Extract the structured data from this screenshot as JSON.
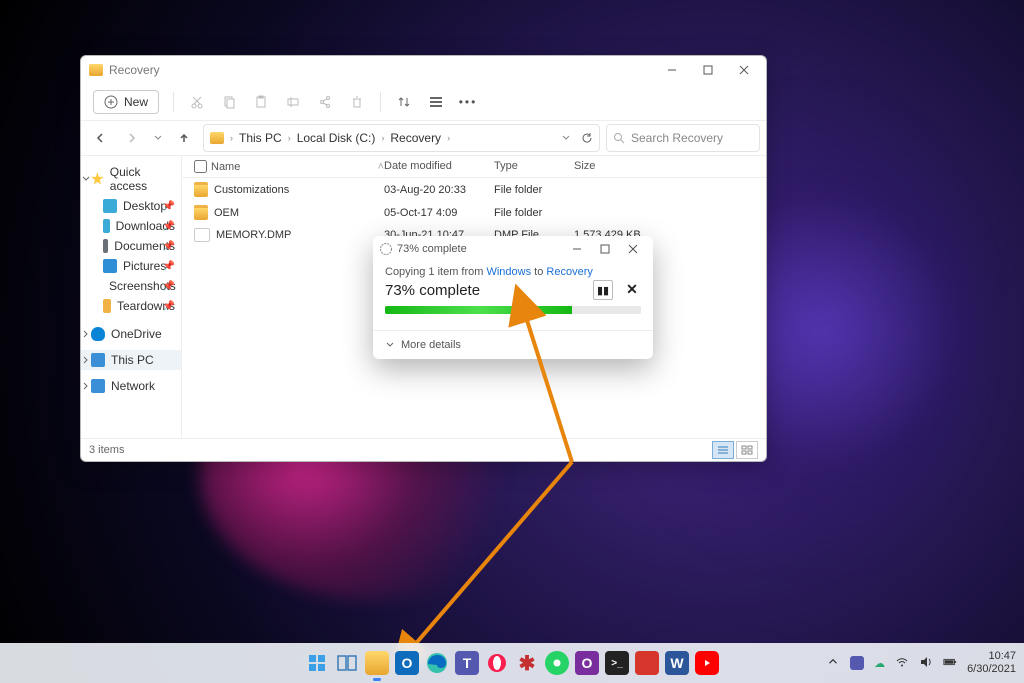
{
  "explorer": {
    "title": "Recovery",
    "new_label": "New",
    "breadcrumbs": [
      "This PC",
      "Local Disk (C:)",
      "Recovery"
    ],
    "search_placeholder": "Search Recovery",
    "columns": {
      "name": "Name",
      "date": "Date modified",
      "type": "Type",
      "size": "Size"
    },
    "rows": [
      {
        "name": "Customizations",
        "date": "03-Aug-20 20:33",
        "type": "File folder",
        "size": "",
        "icon": "folder"
      },
      {
        "name": "OEM",
        "date": "05-Oct-17 4:09",
        "type": "File folder",
        "size": "",
        "icon": "folder"
      },
      {
        "name": "MEMORY.DMP",
        "date": "30-Jun-21 10:47",
        "type": "DMP File",
        "size": "1,573,429 KB",
        "icon": "file"
      }
    ],
    "status": "3 items",
    "sidebar": {
      "quick_access": "Quick access",
      "items": [
        {
          "label": "Desktop",
          "color": "#3aaad6"
        },
        {
          "label": "Downloads",
          "color": "#3aaad6"
        },
        {
          "label": "Documents",
          "color": "#6a7178"
        },
        {
          "label": "Pictures",
          "color": "#2e8fd6"
        },
        {
          "label": "Screenshots",
          "color": "#f0b245"
        },
        {
          "label": "Teardowns",
          "color": "#f0b245"
        }
      ],
      "onedrive": "OneDrive",
      "this_pc": "This PC",
      "network": "Network"
    }
  },
  "copy": {
    "title": "73% complete",
    "line_pre": "Copying 1 item from ",
    "src": "Windows",
    "line_mid": " to ",
    "dst": "Recovery",
    "pct_text": "73% complete",
    "pct": 73,
    "more": "More details"
  },
  "taskbar": {
    "time": "10:47",
    "date": "6/30/2021"
  }
}
